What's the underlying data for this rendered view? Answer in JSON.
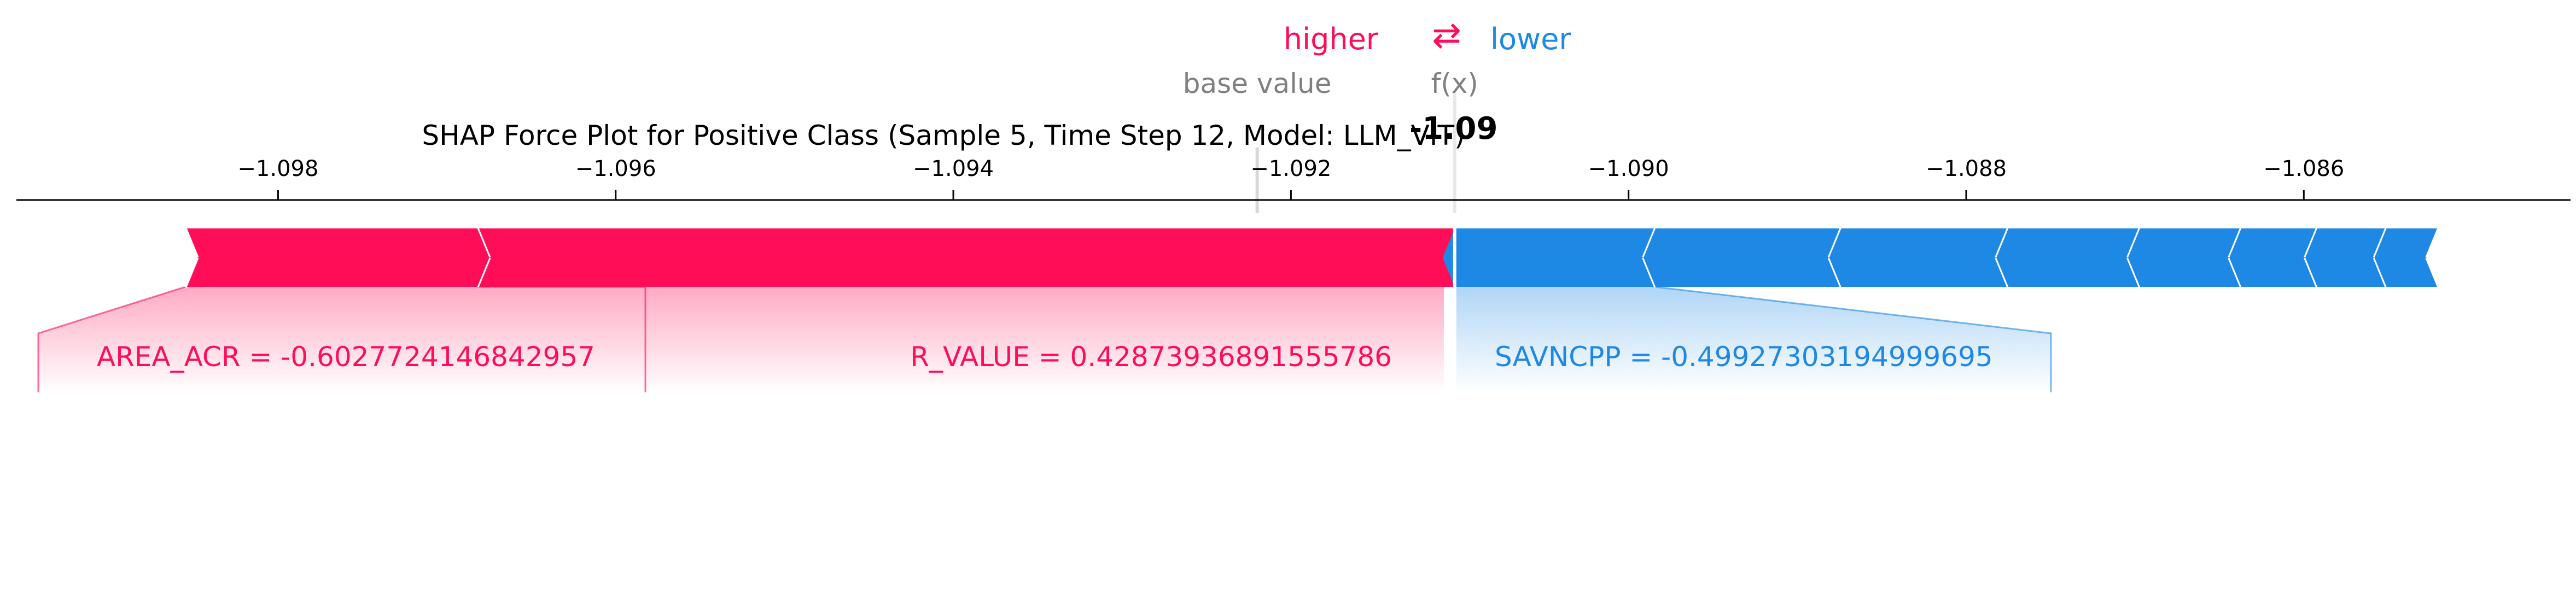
{
  "legend": {
    "higher_label": "higher",
    "lower_label": "lower",
    "arrows_glyph": "⇄"
  },
  "colors": {
    "positive": "#ff0d57",
    "negative": "#1e88e5",
    "text": "#000000",
    "muted": "#808080"
  },
  "chart_data": {
    "type": "force",
    "title": "SHAP Force Plot for Positive Class (Sample 5, Time Step 12, Model: LLM_VIT)",
    "base_value_label": "base value",
    "fx_label": "f(x)",
    "fx_value_text": "-1.09",
    "base_value": -1.0922,
    "fx": -1.09103,
    "xlim": [
      -1.09955,
      -1.08442
    ],
    "ticks": [
      -1.098,
      -1.096,
      -1.094,
      -1.092,
      -1.09,
      -1.088,
      -1.086
    ],
    "tick_labels": [
      "−1.098",
      "−1.096",
      "−1.094",
      "−1.092",
      "−1.090",
      "−1.088",
      "−1.086"
    ],
    "positive_segments": [
      {
        "start": -1.09682,
        "end": -1.09103,
        "label": "R_VALUE = 0.42873936891555786"
      },
      {
        "start": -1.09855,
        "end": -1.09682,
        "label": "AREA_ACR = -0.6027724146842957"
      }
    ],
    "negative_segments": [
      {
        "start": -1.09103,
        "end": -1.08984,
        "label": "SAVNCPP = -0.49927303194999695"
      },
      {
        "start": -1.08984,
        "end": -1.08874,
        "label": ""
      },
      {
        "start": -1.08874,
        "end": -1.08775,
        "label": ""
      },
      {
        "start": -1.08775,
        "end": -1.08697,
        "label": ""
      },
      {
        "start": -1.08697,
        "end": -1.08637,
        "label": ""
      },
      {
        "start": -1.08637,
        "end": -1.08592,
        "label": ""
      },
      {
        "start": -1.08592,
        "end": -1.08551,
        "label": ""
      },
      {
        "start": -1.08551,
        "end": -1.0852,
        "label": ""
      }
    ]
  }
}
